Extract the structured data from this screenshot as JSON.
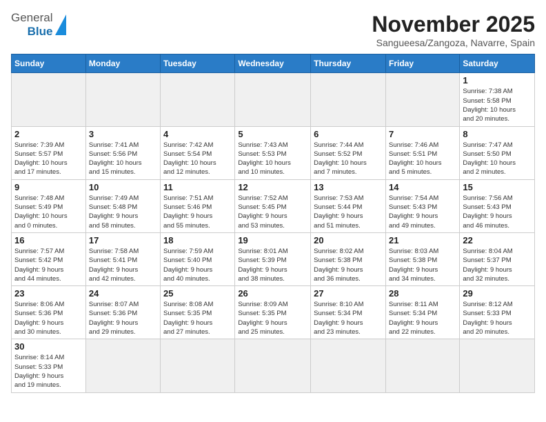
{
  "header": {
    "logo": {
      "general": "General",
      "blue": "Blue"
    },
    "title": "November 2025",
    "location": "Sangueesa/Zangoza, Navarre, Spain"
  },
  "days_of_week": [
    "Sunday",
    "Monday",
    "Tuesday",
    "Wednesday",
    "Thursday",
    "Friday",
    "Saturday"
  ],
  "weeks": [
    [
      {
        "day": null,
        "info": null
      },
      {
        "day": null,
        "info": null
      },
      {
        "day": null,
        "info": null
      },
      {
        "day": null,
        "info": null
      },
      {
        "day": null,
        "info": null
      },
      {
        "day": null,
        "info": null
      },
      {
        "day": "1",
        "info": "Sunrise: 7:38 AM\nSunset: 5:58 PM\nDaylight: 10 hours\nand 20 minutes."
      }
    ],
    [
      {
        "day": "2",
        "info": "Sunrise: 7:39 AM\nSunset: 5:57 PM\nDaylight: 10 hours\nand 17 minutes."
      },
      {
        "day": "3",
        "info": "Sunrise: 7:41 AM\nSunset: 5:56 PM\nDaylight: 10 hours\nand 15 minutes."
      },
      {
        "day": "4",
        "info": "Sunrise: 7:42 AM\nSunset: 5:54 PM\nDaylight: 10 hours\nand 12 minutes."
      },
      {
        "day": "5",
        "info": "Sunrise: 7:43 AM\nSunset: 5:53 PM\nDaylight: 10 hours\nand 10 minutes."
      },
      {
        "day": "6",
        "info": "Sunrise: 7:44 AM\nSunset: 5:52 PM\nDaylight: 10 hours\nand 7 minutes."
      },
      {
        "day": "7",
        "info": "Sunrise: 7:46 AM\nSunset: 5:51 PM\nDaylight: 10 hours\nand 5 minutes."
      },
      {
        "day": "8",
        "info": "Sunrise: 7:47 AM\nSunset: 5:50 PM\nDaylight: 10 hours\nand 2 minutes."
      }
    ],
    [
      {
        "day": "9",
        "info": "Sunrise: 7:48 AM\nSunset: 5:49 PM\nDaylight: 10 hours\nand 0 minutes."
      },
      {
        "day": "10",
        "info": "Sunrise: 7:49 AM\nSunset: 5:48 PM\nDaylight: 9 hours\nand 58 minutes."
      },
      {
        "day": "11",
        "info": "Sunrise: 7:51 AM\nSunset: 5:46 PM\nDaylight: 9 hours\nand 55 minutes."
      },
      {
        "day": "12",
        "info": "Sunrise: 7:52 AM\nSunset: 5:45 PM\nDaylight: 9 hours\nand 53 minutes."
      },
      {
        "day": "13",
        "info": "Sunrise: 7:53 AM\nSunset: 5:44 PM\nDaylight: 9 hours\nand 51 minutes."
      },
      {
        "day": "14",
        "info": "Sunrise: 7:54 AM\nSunset: 5:43 PM\nDaylight: 9 hours\nand 49 minutes."
      },
      {
        "day": "15",
        "info": "Sunrise: 7:56 AM\nSunset: 5:43 PM\nDaylight: 9 hours\nand 46 minutes."
      }
    ],
    [
      {
        "day": "16",
        "info": "Sunrise: 7:57 AM\nSunset: 5:42 PM\nDaylight: 9 hours\nand 44 minutes."
      },
      {
        "day": "17",
        "info": "Sunrise: 7:58 AM\nSunset: 5:41 PM\nDaylight: 9 hours\nand 42 minutes."
      },
      {
        "day": "18",
        "info": "Sunrise: 7:59 AM\nSunset: 5:40 PM\nDaylight: 9 hours\nand 40 minutes."
      },
      {
        "day": "19",
        "info": "Sunrise: 8:01 AM\nSunset: 5:39 PM\nDaylight: 9 hours\nand 38 minutes."
      },
      {
        "day": "20",
        "info": "Sunrise: 8:02 AM\nSunset: 5:38 PM\nDaylight: 9 hours\nand 36 minutes."
      },
      {
        "day": "21",
        "info": "Sunrise: 8:03 AM\nSunset: 5:38 PM\nDaylight: 9 hours\nand 34 minutes."
      },
      {
        "day": "22",
        "info": "Sunrise: 8:04 AM\nSunset: 5:37 PM\nDaylight: 9 hours\nand 32 minutes."
      }
    ],
    [
      {
        "day": "23",
        "info": "Sunrise: 8:06 AM\nSunset: 5:36 PM\nDaylight: 9 hours\nand 30 minutes."
      },
      {
        "day": "24",
        "info": "Sunrise: 8:07 AM\nSunset: 5:36 PM\nDaylight: 9 hours\nand 29 minutes."
      },
      {
        "day": "25",
        "info": "Sunrise: 8:08 AM\nSunset: 5:35 PM\nDaylight: 9 hours\nand 27 minutes."
      },
      {
        "day": "26",
        "info": "Sunrise: 8:09 AM\nSunset: 5:35 PM\nDaylight: 9 hours\nand 25 minutes."
      },
      {
        "day": "27",
        "info": "Sunrise: 8:10 AM\nSunset: 5:34 PM\nDaylight: 9 hours\nand 23 minutes."
      },
      {
        "day": "28",
        "info": "Sunrise: 8:11 AM\nSunset: 5:34 PM\nDaylight: 9 hours\nand 22 minutes."
      },
      {
        "day": "29",
        "info": "Sunrise: 8:12 AM\nSunset: 5:33 PM\nDaylight: 9 hours\nand 20 minutes."
      }
    ],
    [
      {
        "day": "30",
        "info": "Sunrise: 8:14 AM\nSunset: 5:33 PM\nDaylight: 9 hours\nand 19 minutes."
      },
      {
        "day": null,
        "info": null
      },
      {
        "day": null,
        "info": null
      },
      {
        "day": null,
        "info": null
      },
      {
        "day": null,
        "info": null
      },
      {
        "day": null,
        "info": null
      },
      {
        "day": null,
        "info": null
      }
    ]
  ]
}
